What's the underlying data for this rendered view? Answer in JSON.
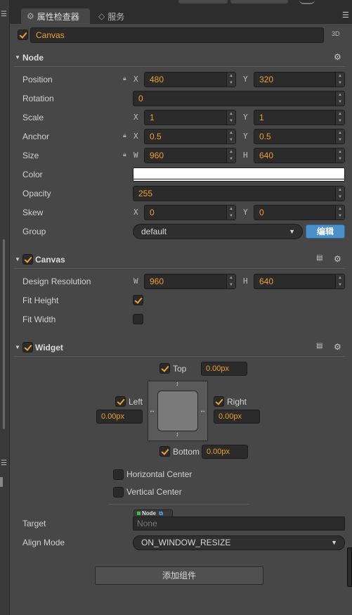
{
  "tabs": {
    "inspector": "属性检查器",
    "services": "服务"
  },
  "node_header": {
    "name": "Canvas",
    "mode": "3D"
  },
  "node_section": {
    "title": "Node",
    "position": {
      "label": "Position",
      "x": "480",
      "y": "320"
    },
    "rotation": {
      "label": "Rotation",
      "value": "0"
    },
    "scale": {
      "label": "Scale",
      "x": "1",
      "y": "1"
    },
    "anchor": {
      "label": "Anchor",
      "x": "0.5",
      "y": "0.5"
    },
    "size": {
      "label": "Size",
      "w": "960",
      "h": "640"
    },
    "color": {
      "label": "Color",
      "value": "#ffffff"
    },
    "opacity": {
      "label": "Opacity",
      "value": "255"
    },
    "skew": {
      "label": "Skew",
      "x": "0",
      "y": "0"
    },
    "group": {
      "label": "Group",
      "value": "default",
      "edit": "编辑"
    }
  },
  "axis": {
    "x": "X",
    "y": "Y",
    "w": "W",
    "h": "H"
  },
  "canvas_section": {
    "title": "Canvas",
    "design_resolution": {
      "label": "Design Resolution",
      "w": "960",
      "h": "640"
    },
    "fit_height": {
      "label": "Fit Height",
      "checked": true
    },
    "fit_width": {
      "label": "Fit Width",
      "checked": false
    }
  },
  "widget_section": {
    "title": "Widget",
    "top": {
      "label": "Top",
      "value": "0.00px"
    },
    "left": {
      "label": "Left",
      "value": "0.00px"
    },
    "right": {
      "label": "Right",
      "value": "0.00px"
    },
    "bottom": {
      "label": "Bottom",
      "value": "0.00px"
    },
    "horizontal_center": {
      "label": "Horizontal Center",
      "checked": false
    },
    "vertical_center": {
      "label": "Vertical Center",
      "checked": false
    },
    "target": {
      "label": "Target",
      "tag": "Node",
      "placeholder": "None"
    },
    "align_mode": {
      "label": "Align Mode",
      "value": "ON_WINDOW_RESIZE"
    }
  },
  "add_component": "添加组件",
  "colors": {
    "accent": "#f0a030",
    "edit_button": "#4a90c9"
  }
}
